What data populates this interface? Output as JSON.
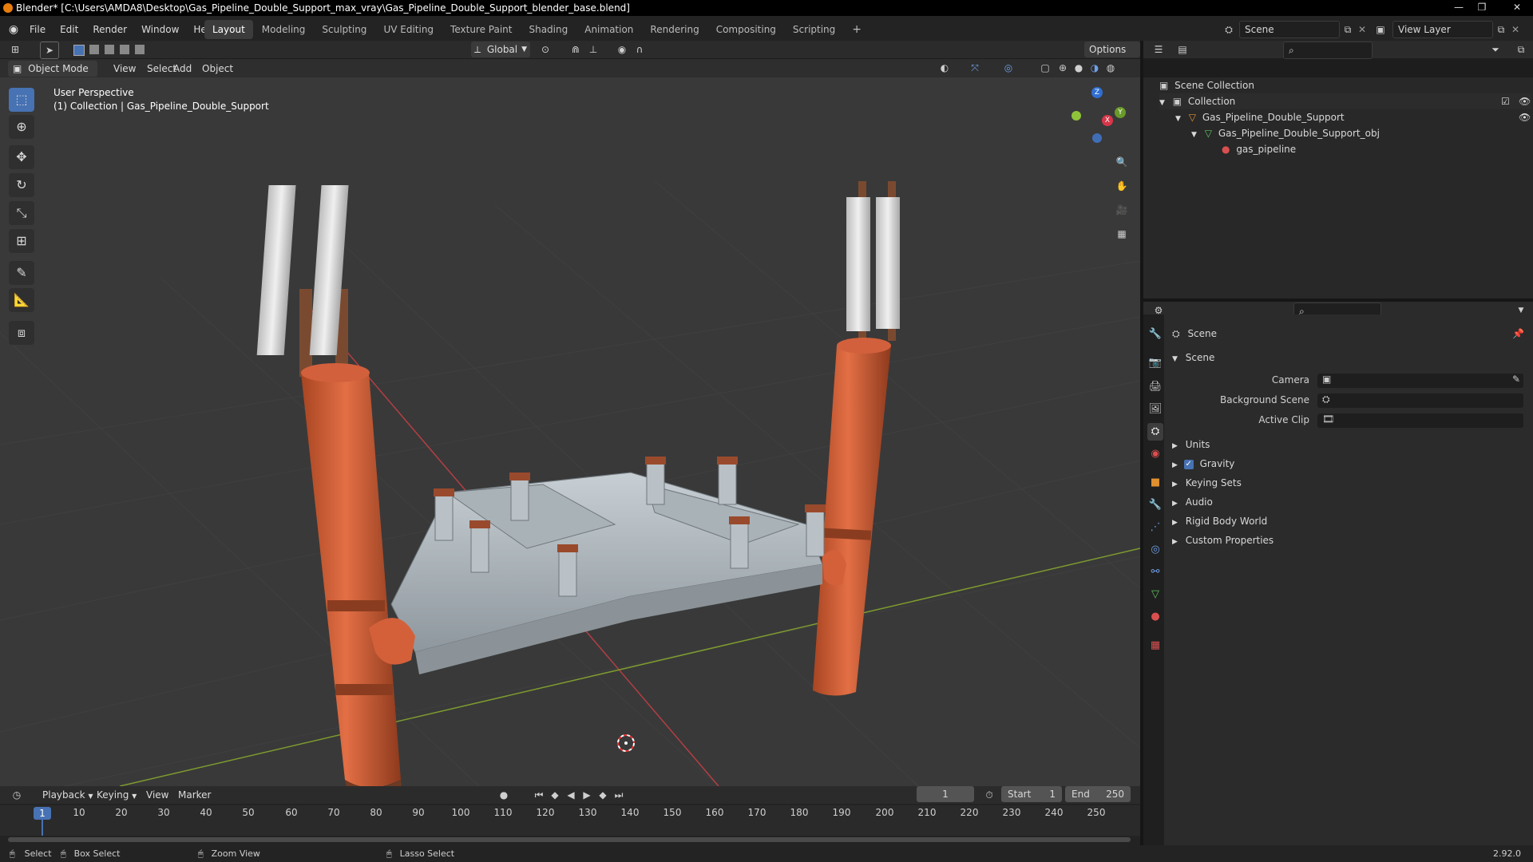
{
  "window": {
    "title": "Blender* [C:\\Users\\AMDA8\\Desktop\\Gas_Pipeline_Double_Support_max_vray\\Gas_Pipeline_Double_Support_blender_base.blend]",
    "minimize": "—",
    "maximize": "❐",
    "close": "✕"
  },
  "menu": {
    "items": [
      "File",
      "Edit",
      "Render",
      "Window",
      "Help"
    ],
    "workspaces": [
      "Layout",
      "Modeling",
      "Sculpting",
      "UV Editing",
      "Texture Paint",
      "Shading",
      "Animation",
      "Rendering",
      "Compositing",
      "Scripting"
    ],
    "add_tab": "+",
    "scene_name": "Scene",
    "view_layer": "View Layer"
  },
  "viewport_header": {
    "transform_orientation": "Global",
    "options": "Options",
    "mode": "Object Mode",
    "menus": [
      "View",
      "Select",
      "Add",
      "Object"
    ]
  },
  "viewport": {
    "perspective": "User Perspective",
    "collection_info": "(1) Collection | Gas_Pipeline_Double_Support",
    "gizmo": {
      "x": "X",
      "y": "Y",
      "z": "Z"
    }
  },
  "outliner": {
    "rows": [
      {
        "label": "Scene Collection"
      },
      {
        "label": "Collection"
      },
      {
        "label": "Gas_Pipeline_Double_Support"
      },
      {
        "label": "Gas_Pipeline_Double_Support_obj"
      },
      {
        "label": "gas_pipeline"
      }
    ]
  },
  "properties": {
    "context": "Scene",
    "section": "Scene",
    "fields": [
      {
        "label": "Camera"
      },
      {
        "label": "Background Scene"
      },
      {
        "label": "Active Clip"
      }
    ],
    "panels": [
      "Units",
      "Gravity",
      "Keying Sets",
      "Audio",
      "Rigid Body World",
      "Custom Properties"
    ],
    "gravity_checked": true
  },
  "timeline": {
    "menus": [
      "Playback",
      "Keying",
      "View",
      "Marker"
    ],
    "current_frame": "1",
    "start_label": "Start",
    "start": "1",
    "end_label": "End",
    "end": "250",
    "ticks": [
      "1",
      "10",
      "20",
      "30",
      "40",
      "50",
      "60",
      "70",
      "80",
      "90",
      "100",
      "110",
      "120",
      "130",
      "140",
      "150",
      "160",
      "170",
      "180",
      "190",
      "200",
      "210",
      "220",
      "230",
      "240",
      "250"
    ]
  },
  "status": {
    "select": "Select",
    "box_select": "Box Select",
    "zoom_view": "Zoom View",
    "lasso_select": "Lasso Select",
    "version": "2.92.0"
  }
}
